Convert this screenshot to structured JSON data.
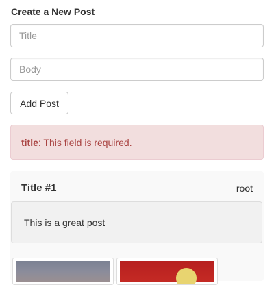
{
  "form": {
    "title": "Create a New Post",
    "title_placeholder": "Title",
    "title_value": "",
    "body_placeholder": "Body",
    "body_value": "",
    "submit_label": "Add Post"
  },
  "alert": {
    "field": "title",
    "message": ": This field is required.",
    "color": "#a94442",
    "background": "#f2dede"
  },
  "posts": [
    {
      "title": "Title #1",
      "author": "root",
      "body": "This is a great post",
      "images": [
        {
          "icon": "photo-thumbnail-icon"
        },
        {
          "icon": "photo-thumbnail-icon"
        }
      ]
    }
  ]
}
